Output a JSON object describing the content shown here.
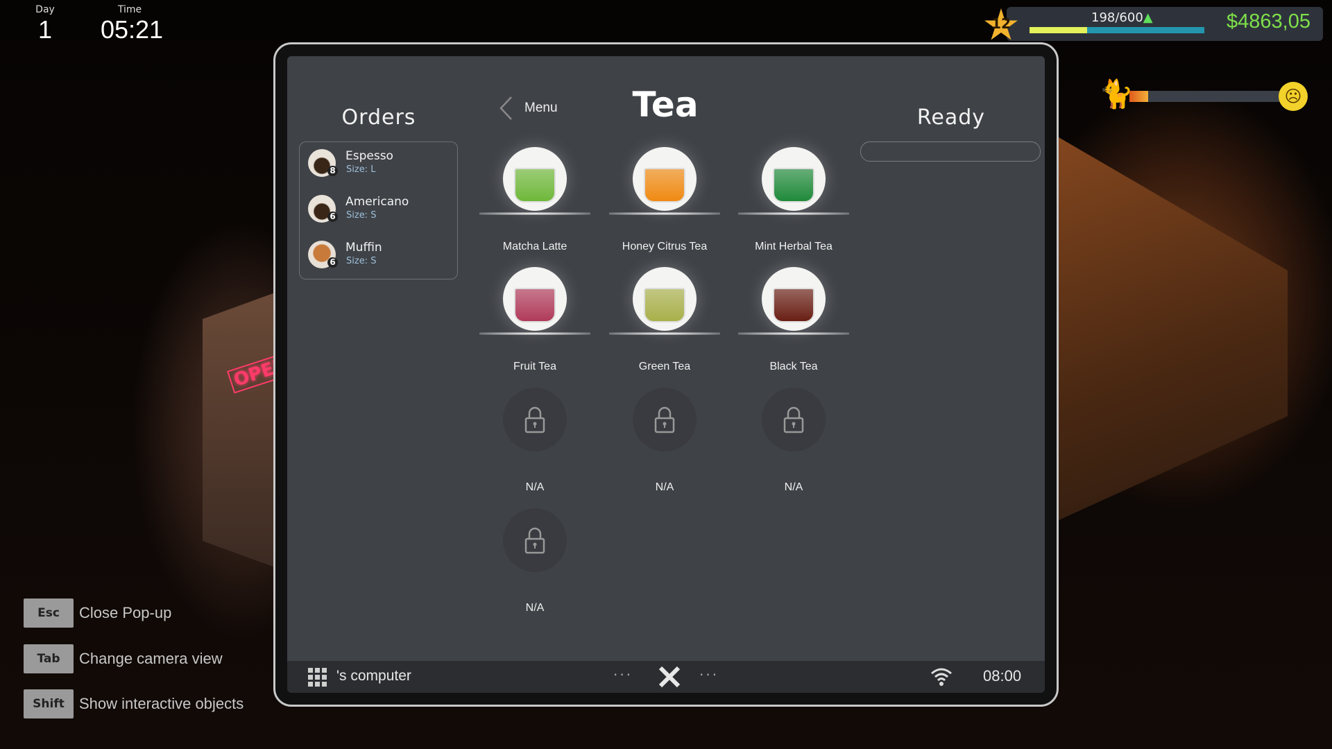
{
  "hud": {
    "day_label": "Day",
    "day": "1",
    "time_label": "Time",
    "time": "05:21",
    "level": "12",
    "xp": "198/600",
    "xp_progress": 0.33,
    "money": "$4863,05",
    "mood_progress": 0.12,
    "colors": {
      "money": "#7ee04a",
      "xp_fill": "#e3f25a",
      "xp_track": "#2396ae"
    }
  },
  "orders": {
    "title": "Orders",
    "items": [
      {
        "name": "Espesso",
        "size": "Size: L",
        "qty": "8",
        "icon": "coffee-cup-icon"
      },
      {
        "name": "Americano",
        "size": "Size: S",
        "qty": "6",
        "icon": "coffee-cup-icon"
      },
      {
        "name": "Muffin",
        "size": "Size: S",
        "qty": "6",
        "icon": "muffin-icon"
      }
    ]
  },
  "nav": {
    "back_label": "Menu",
    "title": "Tea"
  },
  "ready": {
    "title": "Ready"
  },
  "menu_items": [
    {
      "name": "Matcha Latte",
      "color": "#6fb83a"
    },
    {
      "name": "Honey Citrus Tea",
      "color": "#f08a12"
    },
    {
      "name": "Mint Herbal Tea",
      "color": "#1f8a3a"
    },
    {
      "name": "Fruit Tea",
      "color": "#b03a5a"
    },
    {
      "name": "Green Tea",
      "color": "#a8b04a"
    },
    {
      "name": "Black Tea",
      "color": "#6a1e14"
    },
    {
      "name": "N/A",
      "locked": true
    },
    {
      "name": "N/A",
      "locked": true
    },
    {
      "name": "N/A",
      "locked": true
    },
    {
      "name": "N/A",
      "locked": true
    }
  ],
  "taskbar": {
    "owner": "'s computer",
    "clock": "08:00"
  },
  "keyhints": [
    {
      "key": "Esc",
      "label": "Close Pop-up"
    },
    {
      "key": "Tab",
      "label": "Change camera view"
    },
    {
      "key": "Shift",
      "label": "Show interactive objects"
    }
  ],
  "scene": {
    "sign": "OPEN"
  }
}
